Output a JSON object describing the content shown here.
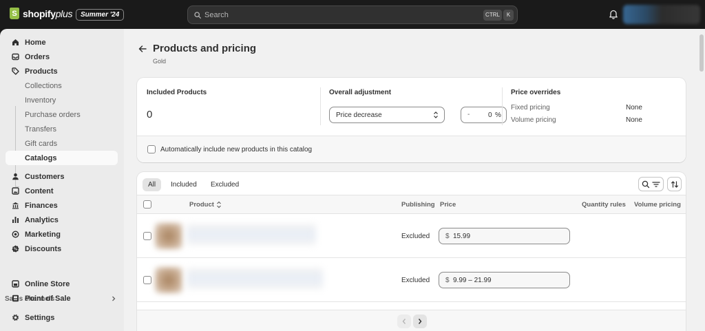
{
  "topbar": {
    "logo_text": "shopify",
    "logo_plus": "plus",
    "edition_badge": "Summer '24",
    "search_placeholder": "Search",
    "shortcut_ctrl": "CTRL",
    "shortcut_key": "K"
  },
  "sidebar": {
    "items": [
      {
        "label": "Home",
        "icon": "home-icon"
      },
      {
        "label": "Orders",
        "icon": "inbox-icon"
      },
      {
        "label": "Products",
        "icon": "tag-icon"
      },
      {
        "label": "Collections"
      },
      {
        "label": "Inventory"
      },
      {
        "label": "Purchase orders"
      },
      {
        "label": "Transfers"
      },
      {
        "label": "Gift cards"
      },
      {
        "label": "Catalogs"
      },
      {
        "label": "Customers",
        "icon": "person-icon"
      },
      {
        "label": "Content",
        "icon": "content-icon"
      },
      {
        "label": "Finances",
        "icon": "bank-icon"
      },
      {
        "label": "Analytics",
        "icon": "bar-chart-icon"
      },
      {
        "label": "Marketing",
        "icon": "target-icon"
      },
      {
        "label": "Discounts",
        "icon": "discount-icon"
      },
      {
        "label": "Online Store",
        "icon": "store-icon"
      },
      {
        "label": "Point of Sale",
        "icon": "pos-icon"
      },
      {
        "label": "Settings",
        "icon": "gear-icon"
      }
    ],
    "sales_channels_label": "Sales channels"
  },
  "page": {
    "title": "Products and pricing",
    "subtitle": "Gold"
  },
  "summary": {
    "included_heading": "Included Products",
    "included_count": "0",
    "adjustment_heading": "Overall adjustment",
    "adjustment_type": "Price decrease",
    "adjustment_sign": "-",
    "adjustment_value": "0",
    "adjustment_unit": "%",
    "overrides_heading": "Price overrides",
    "fixed_label": "Fixed pricing",
    "fixed_value": "None",
    "volume_label": "Volume pricing",
    "volume_value": "None",
    "auto_include_label": "Automatically include new products in this catalog"
  },
  "table": {
    "tabs": [
      "All",
      "Included",
      "Excluded"
    ],
    "columns": {
      "product": "Product",
      "publishing": "Publishing",
      "price": "Price",
      "quantity_rules": "Quantity rules",
      "volume_pricing": "Volume pricing"
    },
    "rows": [
      {
        "publishing": "Excluded",
        "currency": "$",
        "price": "15.99"
      },
      {
        "publishing": "Excluded",
        "currency": "$",
        "price": "9.99 – 21.99"
      }
    ]
  },
  "colors": {
    "topbar_bg": "#1a1a1a",
    "sidebar_bg": "#ebebeb",
    "main_bg": "#f1f1f1",
    "card_bg": "#ffffff",
    "logo_green": "#95bf47"
  }
}
